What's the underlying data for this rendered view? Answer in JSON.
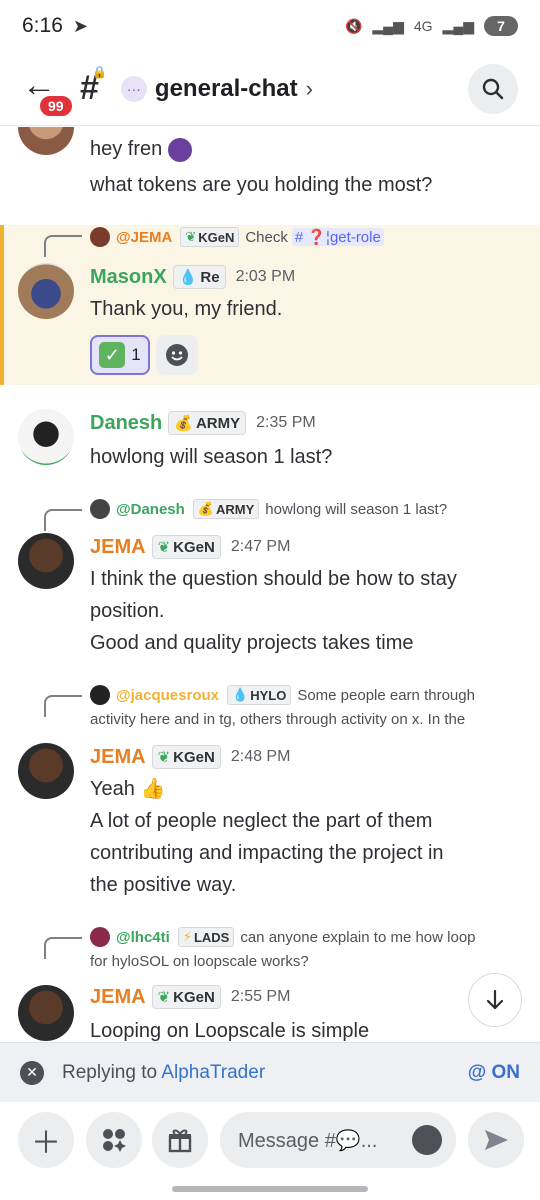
{
  "status_bar": {
    "time": "6:16",
    "battery": "7",
    "network": "4G"
  },
  "header": {
    "unread_count": "99",
    "channel_name": "general-chat",
    "chevron": "›"
  },
  "messages": {
    "first": {
      "line1": "hey fren",
      "line2": "what tokens are you holding the most?"
    },
    "masonx": {
      "reply_to_name": "@JEMA",
      "reply_to_tag": "KGeN",
      "reply_to_text": "Check",
      "reply_channel": "get-role",
      "author": "MasonX",
      "author_color": "#3ba55c",
      "tag": "Re",
      "time": "2:03 PM",
      "text": "Thank you, my friend.",
      "reaction_count": "1"
    },
    "danesh": {
      "author": "Danesh",
      "author_color": "#3ba55c",
      "tag": "ARMY",
      "time": "2:35 PM",
      "text": "howlong will season 1 last?"
    },
    "jema1": {
      "reply_to_name": "@Danesh",
      "reply_to_tag": "ARMY",
      "reply_to_text": "howlong will season 1 last?",
      "author": "JEMA",
      "author_color": "#e67e22",
      "tag": "KGeN",
      "time": "2:47 PM",
      "line1": "I think the question should be how to stay",
      "line2": "position.",
      "line3": "Good and quality projects takes time"
    },
    "jema2": {
      "reply_to_name": "@jacquesroux",
      "reply_to_tag": "HYLO",
      "reply_to_text_1": "Some people earn through",
      "reply_to_text_2": "activity here and in tg, others through activity on x. In the",
      "author": "JEMA",
      "author_color": "#e67e22",
      "tag": "KGeN",
      "time": "2:48 PM",
      "line1": "Yeah",
      "line2": "A lot of people neglect the part of them",
      "line3": "contributing and impacting the project in",
      "line4": "the positive way."
    },
    "jema3": {
      "reply_to_name": "@lhc4ti",
      "reply_to_tag": "LADS",
      "reply_to_text_1": "can anyone explain to me how loop",
      "reply_to_text_2": "for hyloSOL on loopscale works?",
      "author": "JEMA",
      "author_color": "#e67e22",
      "tag": "KGeN",
      "time": "2:55 PM",
      "line1": "Looping on Loopscale is simple"
    }
  },
  "reply_bar": {
    "prefix": "Replying to",
    "target": "AlphaTrader",
    "mention_label": "@ ON"
  },
  "composer": {
    "placeholder": "Message #💬..."
  }
}
